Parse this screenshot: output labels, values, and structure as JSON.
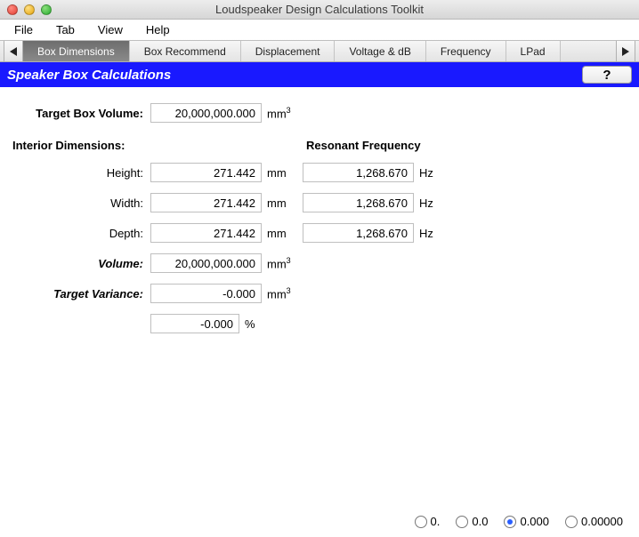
{
  "window": {
    "title": "Loudspeaker Design Calculations Toolkit"
  },
  "menubar": {
    "items": [
      "File",
      "Tab",
      "View",
      "Help"
    ]
  },
  "tabs": {
    "items": [
      "Box Dimensions",
      "Box Recommend",
      "Displacement",
      "Voltage & dB",
      "Frequency",
      "LPad"
    ],
    "active_index": 0
  },
  "section": {
    "title": "Speaker Box Calculations",
    "help_label": "?"
  },
  "labels": {
    "target_box_volume": "Target Box Volume:",
    "interior_dimensions": "Interior Dimensions:",
    "resonant_frequency": "Resonant Frequency",
    "height": "Height:",
    "width": "Width:",
    "depth": "Depth:",
    "volume": "Volume:",
    "target_variance": "Target Variance:"
  },
  "units": {
    "mm": "mm",
    "mm3_base": "mm",
    "mm3_sup": "3",
    "hz": "Hz",
    "percent": "%"
  },
  "values": {
    "target_box_volume": "20,000,000.000",
    "height": "271.442",
    "width": "271.442",
    "depth": "271.442",
    "volume": "20,000,000.000",
    "target_variance": "-0.000",
    "target_variance_pct": "-0.000",
    "rf_height": "1,268.670",
    "rf_width": "1,268.670",
    "rf_depth": "1,268.670"
  },
  "precision": {
    "options": [
      "0.",
      "0.0",
      "0.000",
      "0.00000"
    ],
    "selected_index": 2
  }
}
